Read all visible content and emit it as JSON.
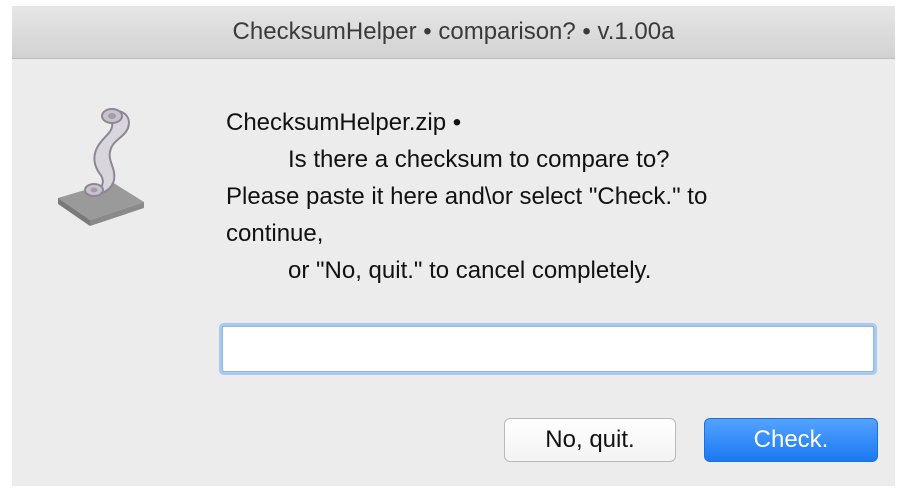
{
  "window": {
    "title": "ChecksumHelper • comparison? • v.1.00a"
  },
  "dialog": {
    "icon": "script-scroll-icon",
    "message_lines": [
      "ChecksumHelper.zip •",
      "Is there a checksum to compare to?",
      "Please paste it here and\\or select \"Check.\" to",
      "continue,",
      "or \"No, quit.\" to cancel completely."
    ],
    "checksum_input": {
      "value": "",
      "placeholder": ""
    },
    "buttons": {
      "cancel_label": "No, quit.",
      "default_label": "Check."
    }
  },
  "colors": {
    "window_background": "#ececec",
    "default_button": "#1a78f2",
    "focus_ring": "#a9c9f3"
  }
}
